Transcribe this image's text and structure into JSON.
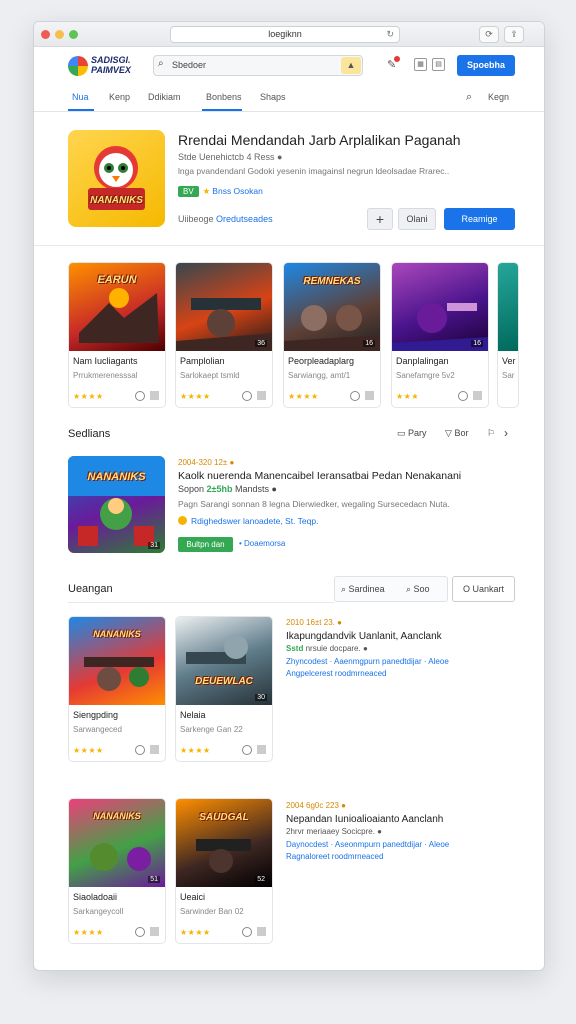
{
  "browser": {
    "url": "loegiknn"
  },
  "header": {
    "logo_line1": "SADISGI.",
    "logo_line2": "PAIMVEX",
    "search_placeholder": "Sbedoer",
    "signin_label": "Spoebha"
  },
  "nav": {
    "tabs": [
      {
        "label": "Nua",
        "active": true
      },
      {
        "label": "Kenp",
        "active": false
      },
      {
        "label": "Ddikiam",
        "active": false
      },
      {
        "label": "Bonbens",
        "active": false
      },
      {
        "label": "Shaps",
        "active": false
      }
    ],
    "right_label": "Kegn"
  },
  "hero": {
    "art_text": "NANANIKS",
    "title": "Rrendai Mendandah Jarb Arplalikan Paganah",
    "subtitle": "Stde Uenehictcb 4 Ress ●",
    "description": "lnga pvandendanl Godoki yesenin imagainsl negrun ldeolsadae Rrarec..",
    "badge": "BV",
    "badge_text": "Bnss Osokan",
    "meta_label": "Uiibeoge",
    "meta_link": "Oredutseades",
    "share_label": "Olani",
    "install_label": "Reamige"
  },
  "carousel": [
    {
      "art": "EARUN",
      "title": "Nam Iucliagants",
      "sub": "Prrukmerenesssal",
      "rating": "★★★★",
      "num": ""
    },
    {
      "art": "",
      "title": "Pamplolian",
      "sub": "Sarlokaept tsmld",
      "rating": "★★★★",
      "num": "36"
    },
    {
      "art": "REMNEKAS",
      "title": "Peorpleadaplarg",
      "sub": "Sarwiangg, amt/1",
      "rating": "★★★★",
      "num": "16"
    },
    {
      "art": "",
      "title": "Danplalingan",
      "sub": "Sanefamgre 5v2",
      "rating": "★★★",
      "num": "16"
    },
    {
      "art": "",
      "title": "Ver",
      "sub": "Sar",
      "rating": "",
      "num": ""
    }
  ],
  "section1": {
    "title": "Sedlians",
    "tool1": "Pary",
    "tool2": "Bor"
  },
  "featured": {
    "art_text": "NANANIKS",
    "date": "2004-320 12± ●",
    "title": "Kaolk nuerenda Manencaibel Ieransatbai Pedan Nenakanani",
    "sub_name": "Sopon",
    "sub_highlight": "2±5hb",
    "sub_rest": "Mandsts ●",
    "description": "Pagn Sarangi sonnan 8 legna Dierwiedker, wegaling Sursecedacn Nuta.",
    "link": "Rdighedswer lanoadete, St. Teqp.",
    "button": "Bultpn dan",
    "tag": "• Doaemorsa"
  },
  "section2": {
    "title": "Ueangan",
    "search": "Sardinea",
    "filter": "Soo",
    "button": "O Uankart"
  },
  "grid": [
    {
      "art": "NANANIKS",
      "title": "Siengpding",
      "sub": "Sarwangeced",
      "rating": "★★★★",
      "num": ""
    },
    {
      "art": "DEUEWLAC",
      "title": "Nelaia",
      "sub": "Sarkenge Gan 22",
      "rating": "★★★★",
      "num": "30"
    },
    {
      "art": "NANANIKS",
      "title": "Siaoladoaii",
      "sub": "Sarkangeycoll",
      "rating": "★★★★",
      "num": "51"
    },
    {
      "art": "SAUDGAL",
      "title": "Ueaici",
      "sub": "Sarwinder Ban 02",
      "rating": "★★★★",
      "num": "52"
    }
  ],
  "list": [
    {
      "date": "2010 16±t 23. ●",
      "title": "Ikapungdandvik Uanlanit, Aanclank",
      "sub_highlight": "Sstd",
      "sub_rest": "nrsuie docpare. ●",
      "link1": "Zhyncodest · Aaenmgpurn panedtdijar · Aleoe",
      "link2": "Angpelcerest roodmrneaced"
    },
    {
      "date": "2004 6g0c 223 ●",
      "title": "Nepandan Iunioalioaianto Aanclanh",
      "sub_highlight": "",
      "sub_rest": "2hrvr meriaaey Socicpre. ●",
      "link1": "Daynocdest · Aseonmpurn panedtdijar · Aleoe",
      "link2": "Ragnaloreet roodmrneaced"
    }
  ],
  "colors": {
    "accent": "#1a73e8",
    "green": "#34a853",
    "star": "#f5b400"
  }
}
